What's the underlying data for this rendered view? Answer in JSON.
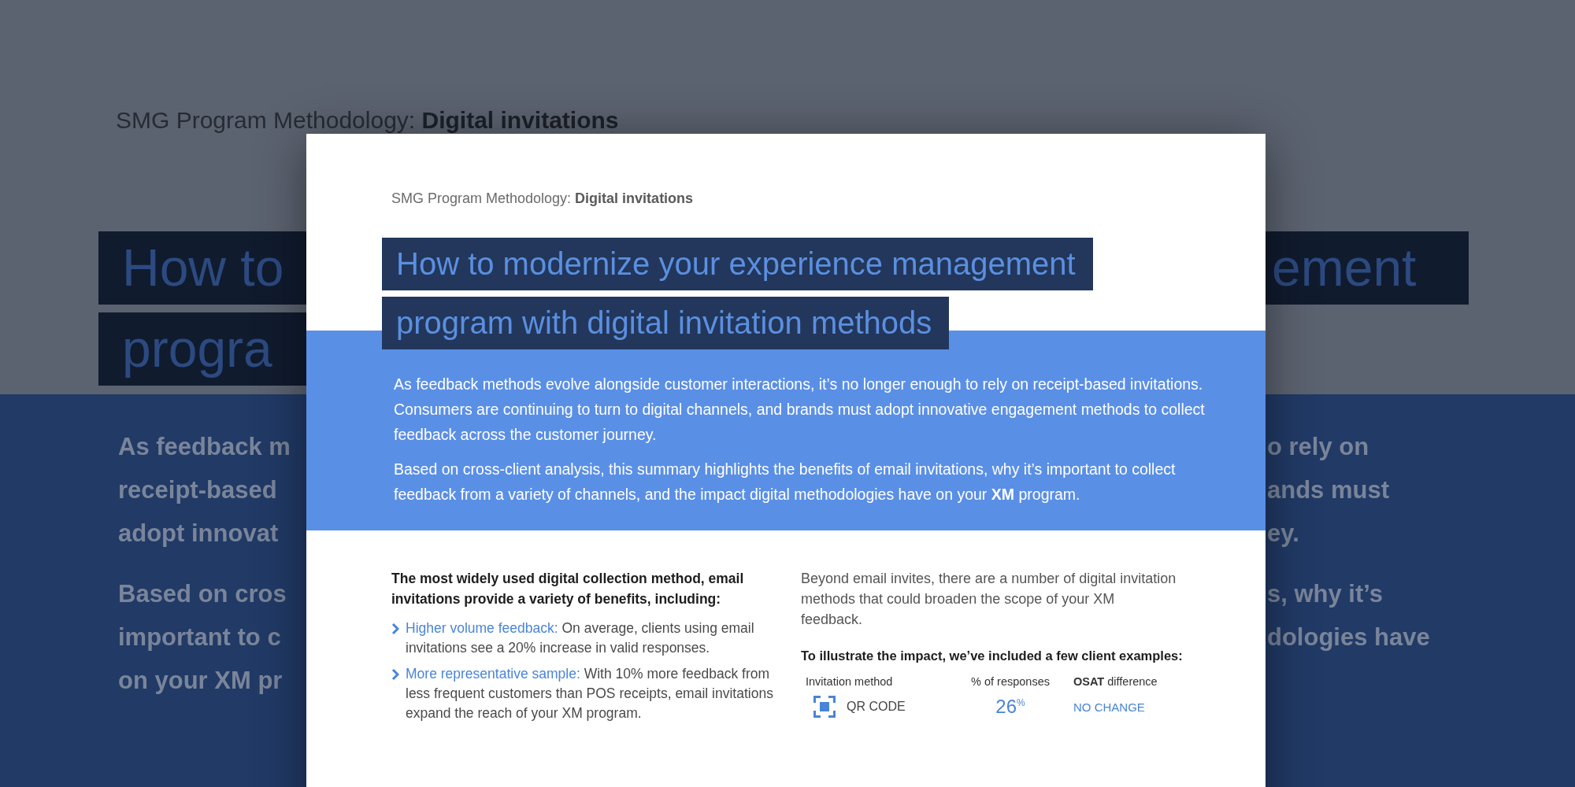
{
  "backdrop": {
    "header": "SMG Program Methodology: **Digital invitations**",
    "title_lines": [
      {
        "left": "How to",
        "right": "ement"
      },
      {
        "left": "progra"
      }
    ],
    "paragraphs": [
      [
        {
          "left": "As feedback m",
          "right": "o rely on"
        },
        {
          "left": "receipt-based",
          "right": "ands must"
        },
        {
          "left": "adopt innovat",
          "right": "ey."
        }
      ],
      [
        {
          "left": "Based on cros",
          "right": "s, why it’s"
        },
        {
          "left": "important to c",
          "right": "dologies have"
        },
        {
          "left": "on your **XM** pr"
        }
      ]
    ]
  },
  "document": {
    "header": "SMG Program Methodology: **Digital invitations**",
    "title_lines": [
      "How to modernize your experience management",
      "program with digital invitation methods"
    ],
    "intro": [
      "As feedback methods evolve alongside customer interactions, it’s no longer enough to rely on receipt-based invitations. Consumers are continuing to turn to digital channels, and brands must adopt innovative engagement methods to collect feedback across the customer journey.",
      "Based on cross-client analysis, this summary highlights the benefits of email invitations, why it’s important to collect feedback from a variety of channels, and the impact digital methodologies have on your **XM** program."
    ],
    "left": {
      "heading": "The most widely used digital collection method, email invitations provide a variety of benefits, including:",
      "bullets": [
        {
          "lead": "Higher volume feedback:",
          "text": "On average, clients using email invitations see a 20% increase in valid responses."
        },
        {
          "lead": "More representative sample:",
          "text": "With 10% more feedback from less frequent customers than POS receipts, email invitations expand the reach of your XM program."
        }
      ]
    },
    "right": {
      "paragraph": "Beyond email invites, there are a number of digital invitation methods that could broaden the scope of your XM feedback.",
      "table_intro": "To illustrate the impact, we’ve included a few client examples:",
      "table": {
        "columns": [
          "Invitation method",
          "% of responses",
          "**OSAT** difference"
        ],
        "rows": [
          {
            "kind": "qr",
            "method": "QR CODE",
            "share": "26$^{%}$",
            "osat": "NO CHANGE"
          }
        ]
      }
    }
  }
}
